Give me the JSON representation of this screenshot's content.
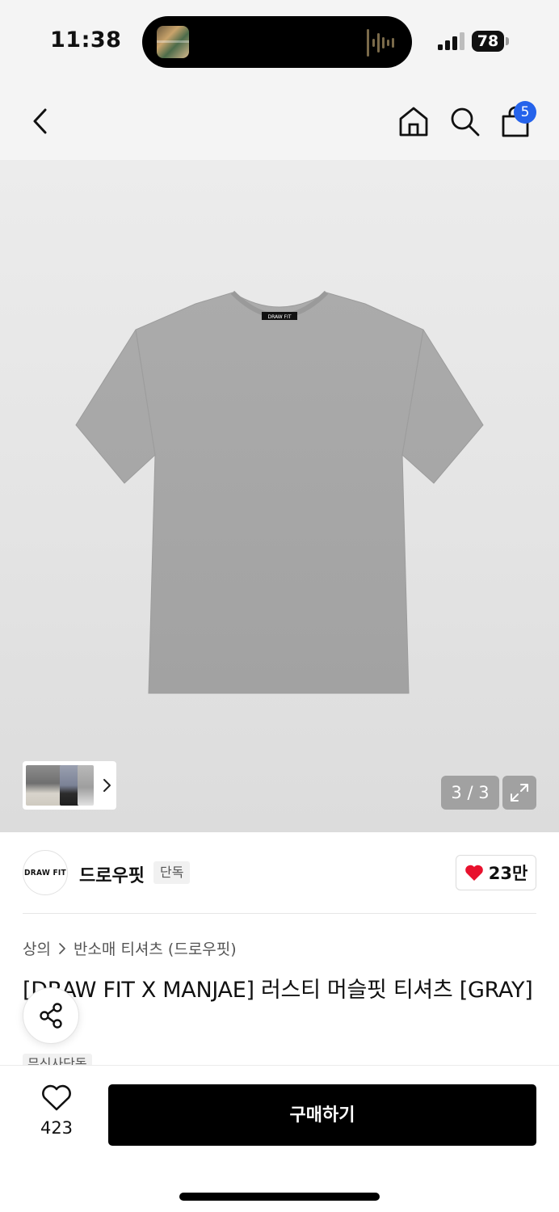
{
  "status_bar": {
    "time": "11:38",
    "battery": "78"
  },
  "nav": {
    "cart_count": "5"
  },
  "gallery": {
    "counter": "3 / 3"
  },
  "brand": {
    "logo_text": "DRAW FIT",
    "name": "드로우핏",
    "exclusive_badge": "단독",
    "likes": "23만"
  },
  "breadcrumb": {
    "level1": "상의",
    "separator": ">",
    "level2": "반소매 티셔츠 (드로우핏)"
  },
  "product": {
    "title": "[DRAW FIT X MANJAE] 러스티 머슬핏 티셔츠 [GRAY]",
    "tag": "무신사단독",
    "neck_label": "DRAW FIT"
  },
  "bottom": {
    "wish_count": "423",
    "buy_label": "구매하기"
  },
  "colors": {
    "accent_blue": "#2563eb",
    "heart_red": "#e8112d",
    "shirt_gray": "#a9a9a9"
  },
  "icons": [
    "back-icon",
    "home-icon",
    "search-icon",
    "shopping-bag-icon",
    "chevron-right-icon",
    "expand-icon",
    "heart-icon",
    "share-icon",
    "heart-outline-icon"
  ]
}
